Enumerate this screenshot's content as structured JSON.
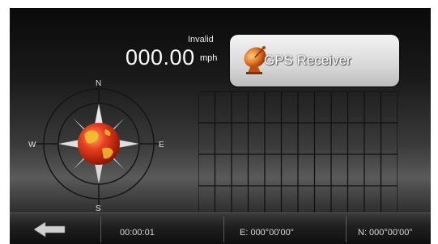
{
  "status": {
    "text": "Invalid"
  },
  "speed": {
    "value": "000.00",
    "unit": "mph"
  },
  "gps_button": {
    "label": "GPS Receiver",
    "icon": "satellite-dish-icon"
  },
  "compass": {
    "north": "N",
    "south": "S",
    "east": "E",
    "west": "W",
    "icon": "globe-icon"
  },
  "signal_grid": {
    "bars": []
  },
  "bottom_bar": {
    "back_icon": "back-arrow-icon",
    "time": "00:00:01",
    "east_coord": "E: 000°00'00\"",
    "north_coord": "N: 000°00'00\""
  },
  "colors": {
    "gps_button_bg": "#d8d8d8",
    "background_dark": "#0a0a0a",
    "globe": "#d83018"
  }
}
